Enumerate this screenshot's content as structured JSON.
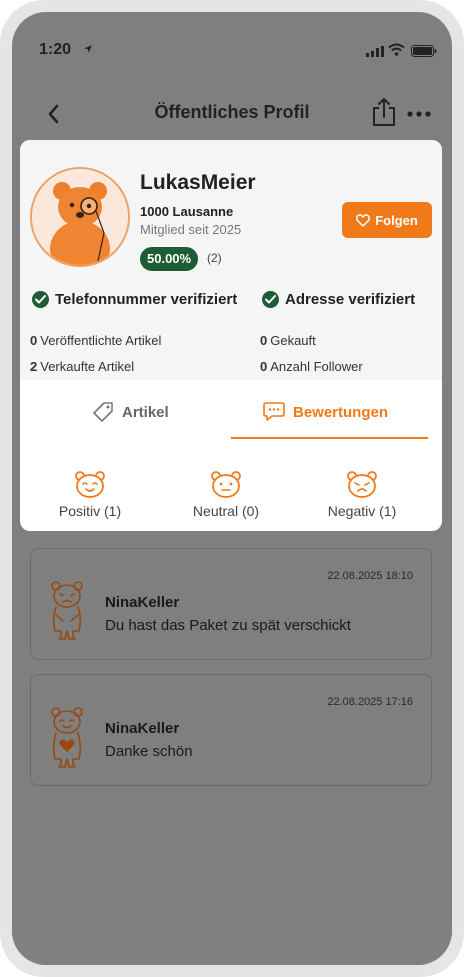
{
  "status_bar": {
    "time": "1:20"
  },
  "nav": {
    "title": "Öffentliches Profil"
  },
  "profile": {
    "username": "LukasMeier",
    "location": "1000 Lausanne",
    "member_since": "Mitglied seit 2025",
    "rating_percent": "50.00%",
    "rating_count": "(2)",
    "follow_label": "Folgen",
    "verifications": [
      "Telefonnummer verifiziert",
      "Adresse verifiziert"
    ],
    "stats": [
      {
        "value": "0",
        "label": "Veröffentlichte Artikel"
      },
      {
        "value": "0",
        "label": "Gekauft"
      },
      {
        "value": "2",
        "label": "Verkaufte Artikel"
      },
      {
        "value": "0",
        "label": "Anzahl Follower"
      }
    ]
  },
  "tabs": [
    {
      "label": "Artikel",
      "active": false,
      "icon": "tag-icon"
    },
    {
      "label": "Bewertungen",
      "active": true,
      "icon": "chat-icon"
    }
  ],
  "filters": [
    {
      "label": "Positiv (1)",
      "icon": "happy-bear-icon"
    },
    {
      "label": "Neutral (0)",
      "icon": "neutral-bear-icon"
    },
    {
      "label": "Negativ (1)",
      "icon": "sad-bear-icon"
    }
  ],
  "reviews": [
    {
      "date": "22.08.2025 18:10",
      "author": "NinaKeller",
      "text": "Du hast das Paket zu spät verschickt",
      "icon": "sad-bear-icon"
    },
    {
      "date": "22.08.2025 17:16",
      "author": "NinaKeller",
      "text": "Danke schön",
      "icon": "heart-bear-icon"
    }
  ],
  "colors": {
    "accent": "#f07a1a",
    "verified": "#1e5c34",
    "overlay": "#7f7f7f"
  }
}
